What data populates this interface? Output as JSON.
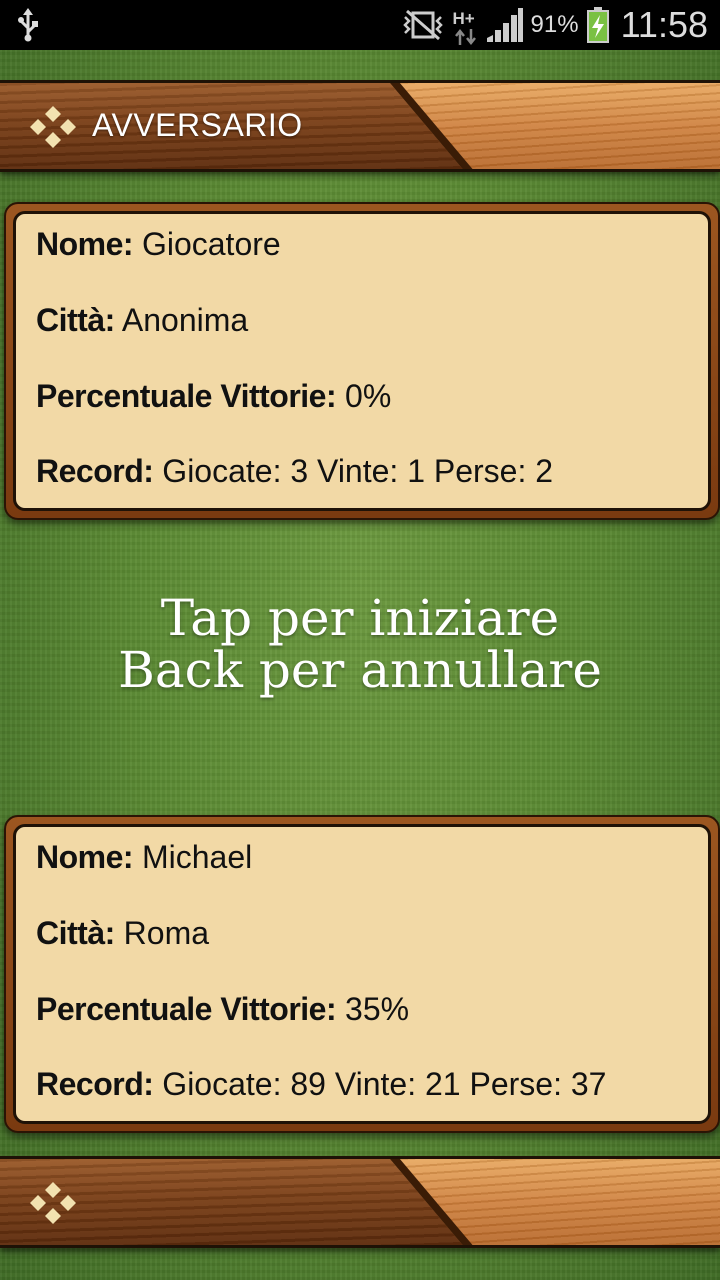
{
  "status_bar": {
    "network": "H+",
    "battery_percent": "91%",
    "time": "11:58"
  },
  "header": {
    "title": "AVVERSARIO"
  },
  "opponent": {
    "name_label": "Nome:",
    "name": "Giocatore",
    "city_label": "Città:",
    "city": "Anonima",
    "win_pct_label": "Percentuale Vittorie:",
    "win_pct": "0%",
    "record_label": "Record:",
    "record": "Giocate: 3 Vinte: 1 Perse: 2"
  },
  "prompt": {
    "line1": "Tap per iniziare",
    "line2": "Back per annullare"
  },
  "player": {
    "name_label": "Nome:",
    "name": "Michael",
    "city_label": "Città:",
    "city": "Roma",
    "win_pct_label": "Percentuale Vittorie:",
    "win_pct": "35%",
    "record_label": "Record:",
    "record": "Giocate: 89 Vinte: 21 Perse: 37"
  },
  "icons": {
    "usb": "usb-icon",
    "mute": "vibrate-muted-icon",
    "data": "data-arrows-icon",
    "signal": "signal-icon",
    "battery": "battery-charging-icon",
    "logo": "diamond-logo-icon"
  },
  "colors": {
    "card_fill": "#f2d9a6",
    "wood_dark": "#7a3f17",
    "wood_light": "#cf8240",
    "felt": "#5b8a33"
  }
}
